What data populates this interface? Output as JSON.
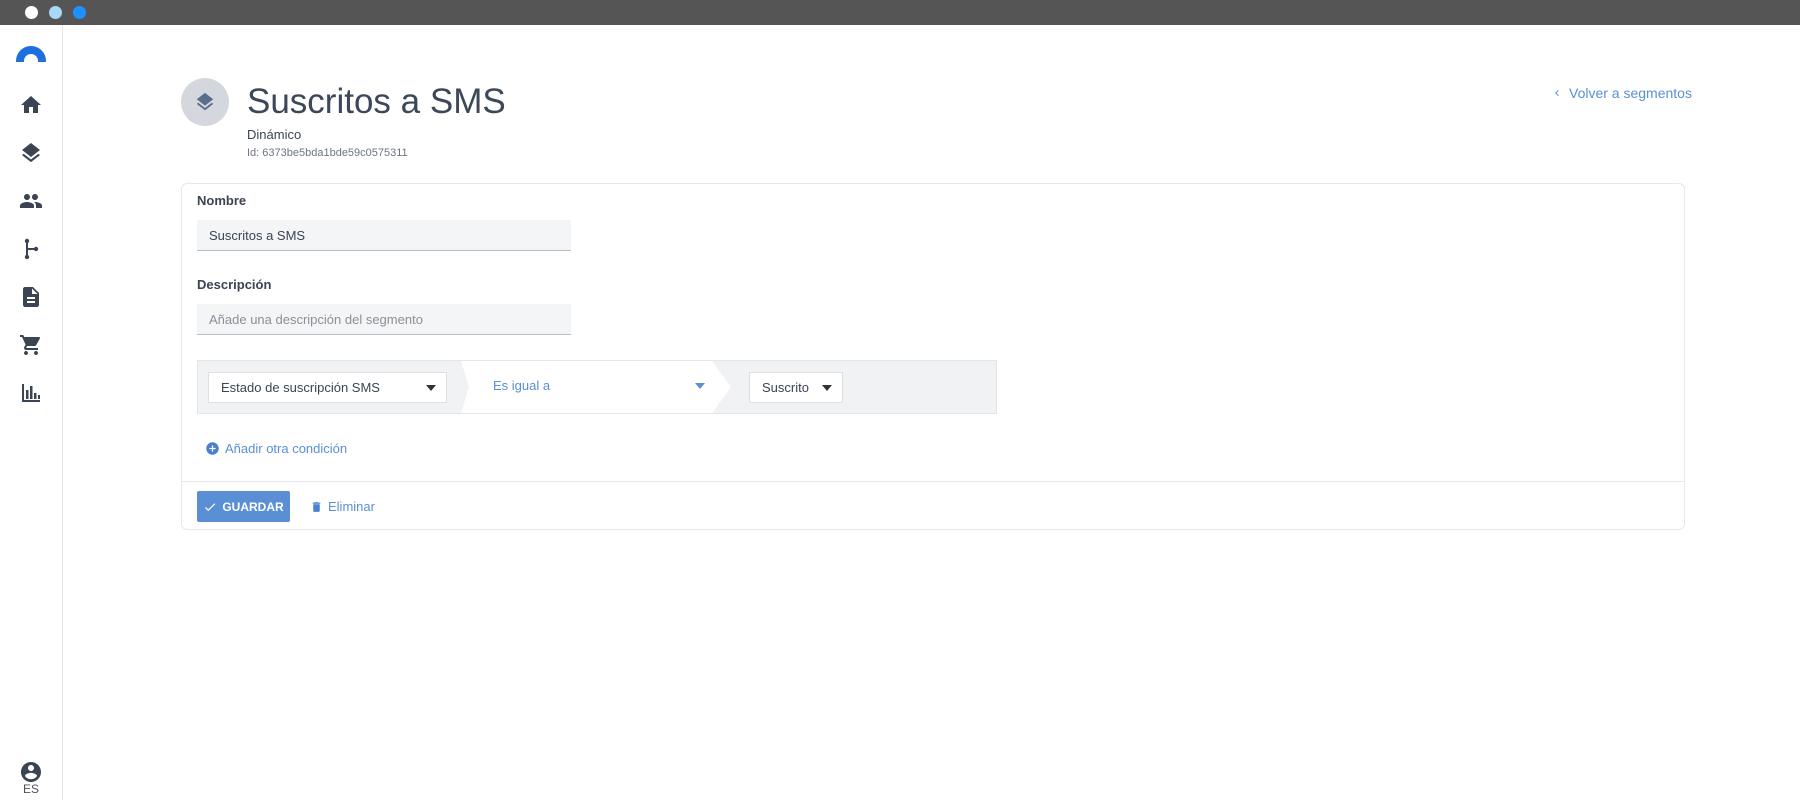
{
  "window": {
    "dot_colors": [
      "#ffffff",
      "#a8d8f8",
      "#1e90ff"
    ]
  },
  "sidebar": {
    "logo_color": "#1e6fe0",
    "items": [
      {
        "icon": "home-icon"
      },
      {
        "icon": "layers-icon"
      },
      {
        "icon": "people-icon"
      },
      {
        "icon": "flow-icon"
      },
      {
        "icon": "document-icon"
      },
      {
        "icon": "cart-icon"
      },
      {
        "icon": "bar-chart-icon"
      }
    ],
    "user_icon": "account-icon",
    "language": "ES"
  },
  "header": {
    "title": "Suscritos a SMS",
    "type": "Dinámico",
    "id_text": "Id: 6373be5bda1bde59c0575311",
    "back_link": "Volver a segmentos"
  },
  "form": {
    "name_label": "Nombre",
    "name_value": "Suscritos a SMS",
    "description_label": "Descripción",
    "description_placeholder": "Añade una descripción del segmento",
    "condition": {
      "field": "Estado de suscripción SMS",
      "operator": "Es igual a",
      "value": "Suscrito"
    },
    "add_condition": "Añadir otra condición",
    "save_label": "GUARDAR",
    "delete_label": "Eliminar"
  },
  "colors": {
    "accent": "#5a8fd6",
    "topbar": "#555555",
    "text": "#3c4858"
  }
}
